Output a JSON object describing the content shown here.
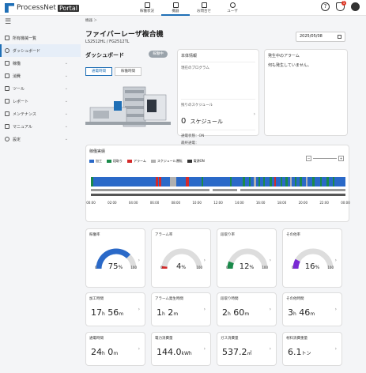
{
  "header": {
    "logo_text": "ProcessNet",
    "logo_badge": "Portal",
    "nav": [
      "稼働状況",
      "機器",
      "お問合せ",
      "ユーザ"
    ],
    "help_icon": "question-icon",
    "bell_badge": "1",
    "menu_icon": "hamburger-icon"
  },
  "sidebar": {
    "items": [
      {
        "label": "所有機械一覧"
      },
      {
        "label": "ダッシュボード"
      },
      {
        "label": "稼働"
      },
      {
        "label": "消費"
      },
      {
        "label": "ツール"
      },
      {
        "label": "レポート"
      },
      {
        "label": "メンテナンス"
      },
      {
        "label": "マニュアル"
      },
      {
        "label": "設定"
      }
    ]
  },
  "breadcrumb": "機器 ＞",
  "page_title": "ファイバーレーザ複合機",
  "model": "LS2512HL / FG2512TL",
  "date": "2025/05/08",
  "dashboard_label": "ダッシュボード",
  "status_tag": "稼働中",
  "tabs": [
    "通電時間",
    "稼働時間"
  ],
  "basic_info": {
    "title": "本体情報",
    "current_program_label": "現在のプログラム",
    "remaining_schedule_label": "残りのスケジュール",
    "remaining_value": "0",
    "remaining_unit": "スケジュール",
    "power_status": "通電状態：ON",
    "last_power": "最終通電："
  },
  "alarm": {
    "title": "発生中のアラーム",
    "message": "何も発生していません。"
  },
  "ops": {
    "title": "稼働実績",
    "legend": [
      {
        "label": "加工",
        "color": "#2a69c8"
      },
      {
        "label": "段取り",
        "color": "#1a8a4a"
      },
      {
        "label": "アラーム",
        "color": "#d42a2a"
      },
      {
        "label": "スケジュール運転",
        "color": "#b0b0b0"
      },
      {
        "label": "電源ON",
        "color": "#333333"
      }
    ],
    "times": [
      "00:00",
      "02:00",
      "04:00",
      "06:00",
      "08:00",
      "10:00",
      "12:00",
      "14:00",
      "16:00",
      "18:00",
      "20:00",
      "22:00",
      "00:00"
    ]
  },
  "gauges": [
    {
      "title": "稼働率",
      "value": "75",
      "unit": "%",
      "fraction": 0.75,
      "color": "#2a69c8",
      "min": "0",
      "max": "100"
    },
    {
      "title": "アラーム率",
      "value": "4",
      "unit": "%",
      "fraction": 0.04,
      "color": "#d42a2a",
      "min": "0",
      "max": "100"
    },
    {
      "title": "段取り率",
      "value": "12",
      "unit": "%",
      "fraction": 0.12,
      "color": "#1a8a4a",
      "min": "0",
      "max": "100"
    },
    {
      "title": "その他率",
      "value": "16",
      "unit": "%",
      "fraction": 0.16,
      "color": "#7a2ad4",
      "min": "0",
      "max": "100"
    }
  ],
  "stats_row1": [
    {
      "title": "加工時間",
      "v1": "17",
      "u1": "h",
      "v2": "56",
      "u2": "m"
    },
    {
      "title": "アラーム発生時間",
      "v1": "1",
      "u1": "h",
      "v2": "2",
      "u2": "m"
    },
    {
      "title": "段取り時間",
      "v1": "2",
      "u1": "h",
      "v2": "60",
      "u2": "m"
    },
    {
      "title": "その他時間",
      "v1": "3",
      "u1": "h",
      "v2": "46",
      "u2": "m"
    }
  ],
  "stats_row2": [
    {
      "title": "通電時間",
      "v1": "24",
      "u1": "h",
      "v2": "0",
      "u2": "m"
    },
    {
      "title": "電力消費量",
      "v1": "144.0",
      "u1": "kWh",
      "v2": "",
      "u2": ""
    },
    {
      "title": "ガス消費量",
      "v1": "537.2",
      "u1": "㎥",
      "v2": "",
      "u2": ""
    },
    {
      "title": "材料消費重量",
      "v1": "6.1",
      "u1": "トン",
      "v2": "",
      "u2": ""
    }
  ]
}
